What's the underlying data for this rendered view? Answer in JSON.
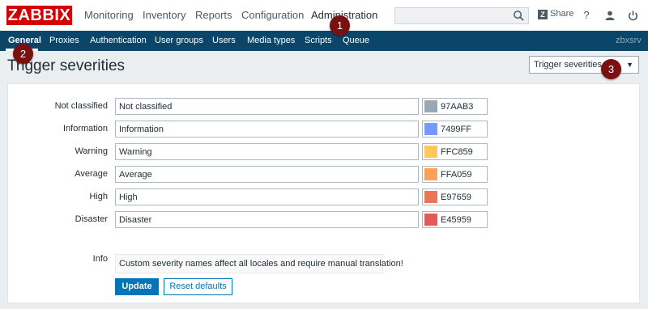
{
  "header": {
    "logo": "ZABBIX",
    "nav": [
      "Monitoring",
      "Inventory",
      "Reports",
      "Configuration",
      "Administration"
    ],
    "active_nav": "Administration",
    "search": {
      "value": "",
      "placeholder": ""
    },
    "share_label": "Share",
    "share_badge": "Z",
    "help_label": "?"
  },
  "subnav": {
    "items": [
      "General",
      "Proxies",
      "Authentication",
      "User groups",
      "Users",
      "Media types",
      "Scripts",
      "Queue"
    ],
    "active": "General",
    "server": "zbxsrv"
  },
  "page": {
    "title": "Trigger severities",
    "selector": "Trigger severities"
  },
  "severities": [
    {
      "label": "Not classified",
      "name": "Not classified",
      "color": "97AAB3"
    },
    {
      "label": "Information",
      "name": "Information",
      "color": "7499FF"
    },
    {
      "label": "Warning",
      "name": "Warning",
      "color": "FFC859"
    },
    {
      "label": "Average",
      "name": "Average",
      "color": "FFA059"
    },
    {
      "label": "High",
      "name": "High",
      "color": "E97659"
    },
    {
      "label": "Disaster",
      "name": "Disaster",
      "color": "E45959"
    }
  ],
  "info": {
    "label": "Info",
    "text": "Custom severity names affect all locales and require manual translation!"
  },
  "buttons": {
    "update": "Update",
    "reset": "Reset defaults"
  },
  "markers": [
    "1",
    "2",
    "3"
  ],
  "colors": {
    "brand": "#d40000",
    "subnav": "#0a466a",
    "primary": "#0275b8",
    "marker": "#7a1010"
  }
}
